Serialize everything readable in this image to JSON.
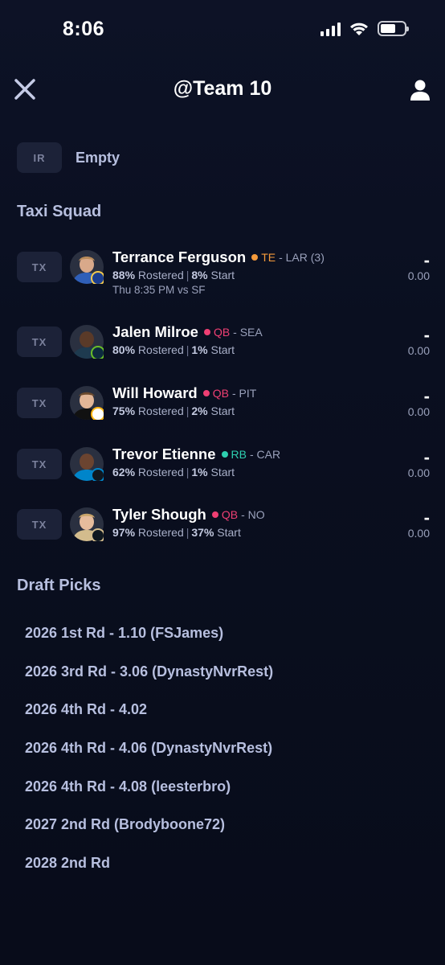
{
  "status_bar": {
    "time": "8:06"
  },
  "header": {
    "title": "@Team 10"
  },
  "ir": {
    "badge": "IR",
    "label": "Empty"
  },
  "taxi_squad": {
    "title": "Taxi Squad",
    "players": [
      {
        "slot": "TX",
        "name": "Terrance Ferguson",
        "position": "TE",
        "position_color": "#f59a3b",
        "team": "- LAR (3)",
        "rostered": "88%",
        "rostered_label": "Rostered",
        "start": "8%",
        "start_label": "Start",
        "game": "Thu 8:35 PM vs SF",
        "score_dash": "-",
        "score": "0.00"
      },
      {
        "slot": "TX",
        "name": "Jalen Milroe",
        "position": "QB",
        "position_color": "#ef3f73",
        "team": "- SEA",
        "rostered": "80%",
        "rostered_label": "Rostered",
        "start": "1%",
        "start_label": "Start",
        "game": "",
        "score_dash": "-",
        "score": "0.00"
      },
      {
        "slot": "TX",
        "name": "Will Howard",
        "position": "QB",
        "position_color": "#ef3f73",
        "team": "- PIT",
        "rostered": "75%",
        "rostered_label": "Rostered",
        "start": "2%",
        "start_label": "Start",
        "game": "",
        "score_dash": "-",
        "score": "0.00"
      },
      {
        "slot": "TX",
        "name": "Trevor Etienne",
        "position": "RB",
        "position_color": "#2ecfb0",
        "team": "- CAR",
        "rostered": "62%",
        "rostered_label": "Rostered",
        "start": "1%",
        "start_label": "Start",
        "game": "",
        "score_dash": "-",
        "score": "0.00"
      },
      {
        "slot": "TX",
        "name": "Tyler Shough",
        "position": "QB",
        "position_color": "#ef3f73",
        "team": "- NO",
        "rostered": "97%",
        "rostered_label": "Rostered",
        "start": "37%",
        "start_label": "Start",
        "game": "",
        "score_dash": "-",
        "score": "0.00"
      }
    ]
  },
  "draft_picks": {
    "title": "Draft Picks",
    "items": [
      "2026 1st Rd - 1.10 (FSJames)",
      "2026 3rd Rd - 3.06 (DynastyNvrRest)",
      "2026 4th Rd - 4.02",
      "2026 4th Rd - 4.06 (DynastyNvrRest)",
      "2026 4th Rd - 4.08 (leesterbro)",
      "2027 2nd Rd (Brodyboone72)",
      "2028 2nd Rd"
    ]
  }
}
